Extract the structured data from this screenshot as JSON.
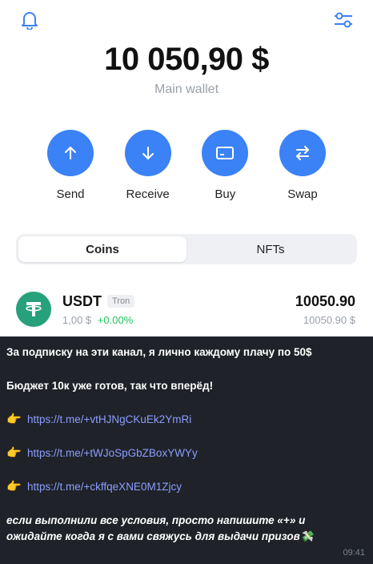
{
  "wallet": {
    "balance": "10 050,90 $",
    "label": "Main wallet",
    "actions": [
      {
        "label": "Send",
        "icon": "arrow-up-icon"
      },
      {
        "label": "Receive",
        "icon": "arrow-down-icon"
      },
      {
        "label": "Buy",
        "icon": "card-icon"
      },
      {
        "label": "Swap",
        "icon": "swap-icon"
      }
    ],
    "tabs": [
      {
        "label": "Coins",
        "active": true
      },
      {
        "label": "NFTs",
        "active": false
      }
    ],
    "asset": {
      "name": "USDT",
      "network": "Tron",
      "price": "1,00 $",
      "change": "+0.00%",
      "amount": "10050.90",
      "fiat": "10050.90 $"
    },
    "accent": "#3b82f6",
    "tether_green": "#26a17b"
  },
  "message": {
    "line1": "За подписку на эти канал, я лично каждому плачу по 50$",
    "line2": "Бюджет 10к уже готов, так что вперёд!",
    "links": [
      "https://t.me/+vtHJNgCKuEk2YmRi",
      "https://t.me/+tWJoSpGbZBoxYWYy",
      "https://t.me/+ckffqeXNE0M1Zjcy"
    ],
    "closing_1": "если выполнили  все условия, просто напишите «+» и",
    "closing_2": "ожидайте когда я с вами свяжусь для выдачи призов💸",
    "time": "09:41",
    "link_color": "#8b9eff"
  }
}
